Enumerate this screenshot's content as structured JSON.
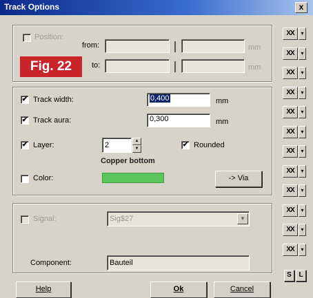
{
  "window": {
    "title": "Track Options",
    "close_label": "x"
  },
  "figure_label": "Fig. 22",
  "position": {
    "label": "Position:",
    "checked": false,
    "from_label": "from:",
    "to_label": "to:",
    "from_x": "",
    "from_y": "",
    "to_x": "",
    "to_y": "",
    "separator": "|",
    "unit": "mm"
  },
  "track": {
    "width_label": "Track width:",
    "width_checked": true,
    "width_value": "0,400",
    "width_unit": "mm",
    "aura_label": "Track aura:",
    "aura_checked": true,
    "aura_value": "0,300",
    "aura_unit": "mm",
    "layer_label": "Layer:",
    "layer_checked": true,
    "layer_value": "2",
    "layer_name": "Copper bottom",
    "rounded_label": "Rounded",
    "rounded_checked": true,
    "color_label": "Color:",
    "color_checked": false,
    "color_value": "#5cc45c",
    "via_button": "-> Via"
  },
  "signal": {
    "label": "Signal:",
    "checked": false,
    "value": "Sig$27",
    "component_label": "Component:",
    "component_value": "Bauteil"
  },
  "buttons": {
    "help": "Help",
    "ok": "Ok",
    "cancel": "Cancel"
  },
  "side_buttons": {
    "icon_label": "XX",
    "arrow_label": "▾",
    "count": 12,
    "s_label": "S",
    "l_label": "L"
  },
  "check_mark": "✔"
}
